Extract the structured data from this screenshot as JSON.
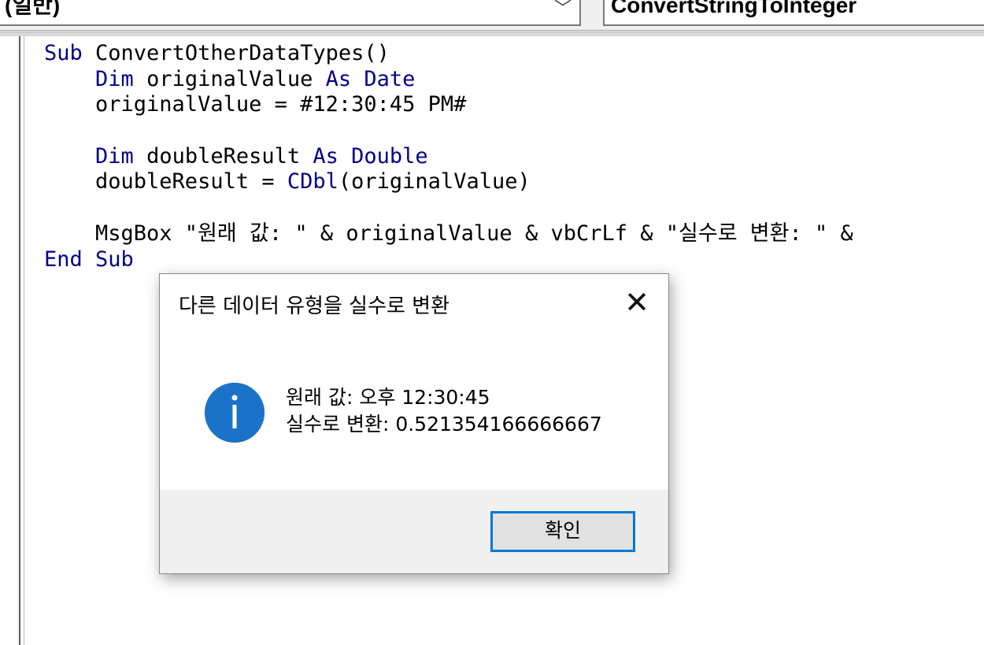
{
  "toolbar": {
    "object_combo": "(일반)",
    "procedure_combo": "ConvertStringToInteger"
  },
  "code_lines": [
    [
      {
        "t": "Sub ",
        "kw": true
      },
      {
        "t": "ConvertOtherDataTypes()"
      }
    ],
    [
      {
        "t": "    "
      },
      {
        "t": "Dim ",
        "kw": true
      },
      {
        "t": "originalValue "
      },
      {
        "t": "As Date",
        "kw": true
      }
    ],
    [
      {
        "t": "    originalValue = #12:30:45 PM#"
      }
    ],
    [
      {
        "t": ""
      }
    ],
    [
      {
        "t": "    "
      },
      {
        "t": "Dim ",
        "kw": true
      },
      {
        "t": "doubleResult "
      },
      {
        "t": "As Double",
        "kw": true
      }
    ],
    [
      {
        "t": "    doubleResult = "
      },
      {
        "t": "CDbl",
        "kw": true
      },
      {
        "t": "(originalValue)"
      }
    ],
    [
      {
        "t": ""
      }
    ],
    [
      {
        "t": "    MsgBox \"원래 값: \" & originalValue & vbCrLf & \"실수로 변환: \" & "
      }
    ],
    [
      {
        "t": "End Sub",
        "kw": true
      }
    ]
  ],
  "dialog": {
    "title": "다른 데이터 유형을 실수로 변환",
    "close_glyph": "✕",
    "icon": "information-icon",
    "icon_letter": "i",
    "message_line1": "원래 값: 오후 12:30:45",
    "message_line2": "실수로 변환: 0.521354166666667",
    "ok_label": "확인"
  },
  "colors": {
    "keyword": "#00008b",
    "info_icon": "#1a73c8",
    "button_focus": "#0078d7"
  }
}
